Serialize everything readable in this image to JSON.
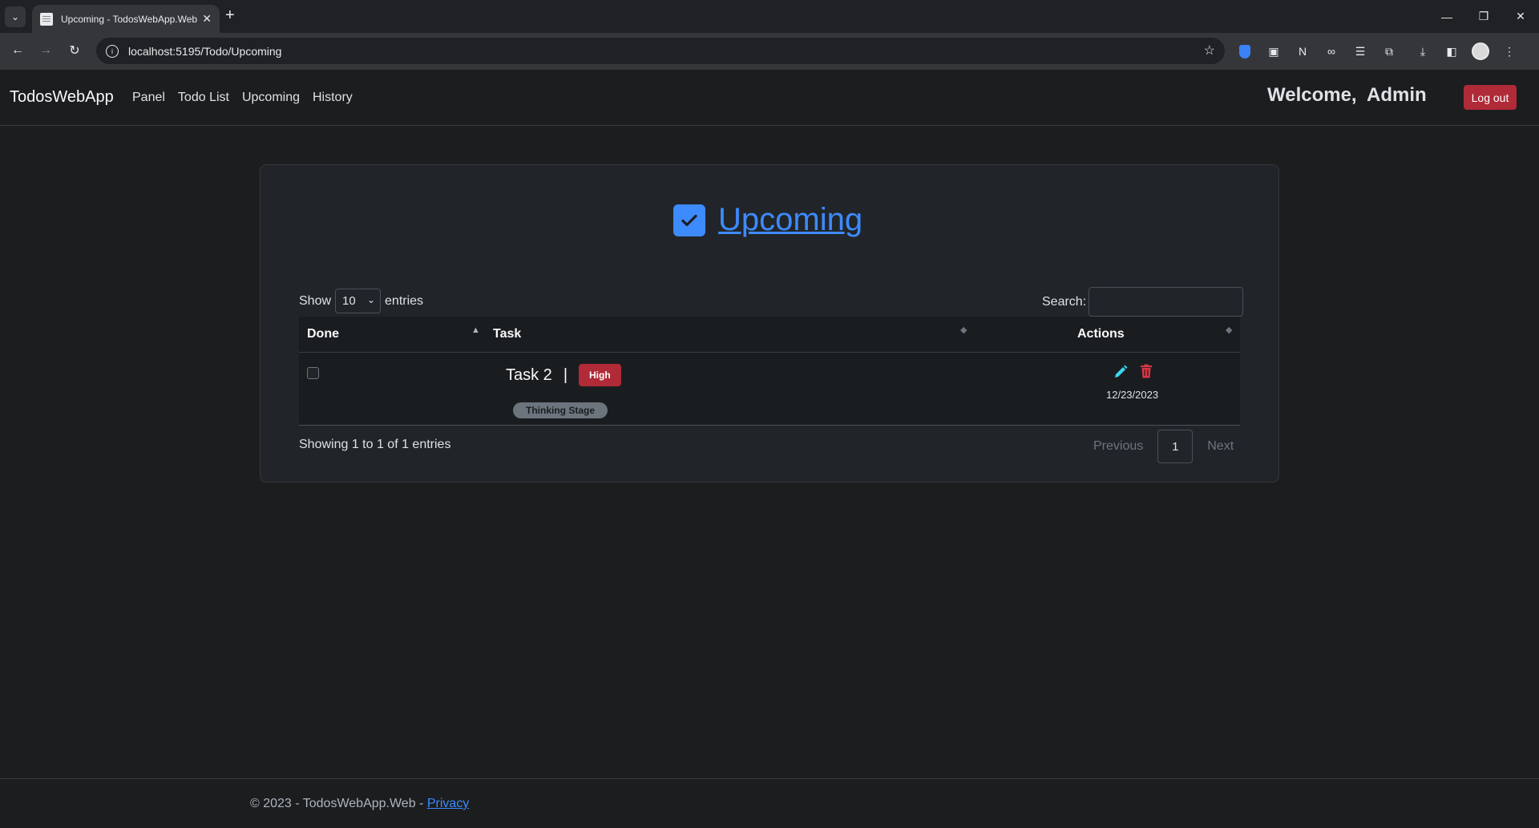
{
  "browser": {
    "tab_title": "Upcoming - TodosWebApp.Web",
    "url": "localhost:5195/Todo/Upcoming"
  },
  "navbar": {
    "brand": "TodosWebApp",
    "links": [
      "Panel",
      "Todo List",
      "Upcoming",
      "History"
    ],
    "welcome": "Welcome,  Admin",
    "logout_label": "Log out"
  },
  "page": {
    "title": "Upcoming",
    "accent_color": "#3d8bfd"
  },
  "table_controls": {
    "show_label": "Show",
    "page_length": "10",
    "entries_label": "entries",
    "search_label": "Search:",
    "search_value": ""
  },
  "table": {
    "columns": [
      "Done",
      "Task",
      "Actions"
    ],
    "rows": [
      {
        "done": false,
        "task": "Task 2",
        "separator": "|",
        "priority": "High",
        "stage": "Thinking Stage",
        "due_date": "12/23/2023"
      }
    ]
  },
  "pagination": {
    "info": "Showing 1 to 1 of 1 entries",
    "previous": "Previous",
    "current_page": "1",
    "next": "Next"
  },
  "footer": {
    "text": "© 2023 - TodosWebApp.Web - ",
    "privacy_link": "Privacy"
  }
}
